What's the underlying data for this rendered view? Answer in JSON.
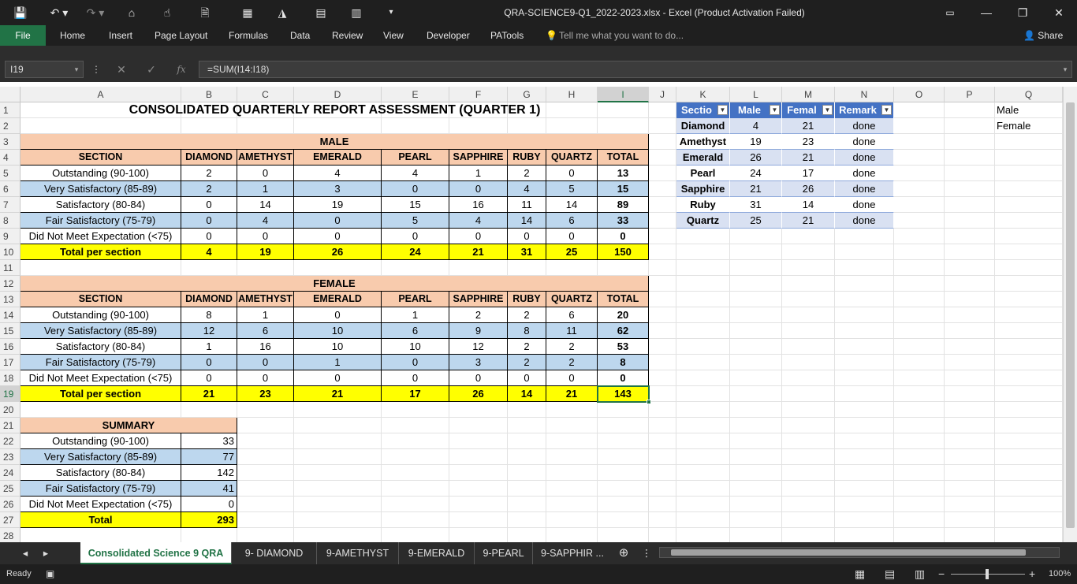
{
  "window": {
    "title": "QRA-SCIENCE9-Q1_2022-2023.xlsx - Excel (Product Activation Failed)"
  },
  "ribbon": {
    "tabs": [
      "File",
      "Home",
      "Insert",
      "Page Layout",
      "Formulas",
      "Data",
      "Review",
      "View",
      "Developer",
      "PATools"
    ],
    "tell_me": "Tell me what you want to do...",
    "share": "Share"
  },
  "formula_bar": {
    "name_box": "I19",
    "fx": "fx",
    "formula": "=SUM(I14:I18)"
  },
  "sheet": {
    "title": "CONSOLIDATED QUARTERLY REPORT ASSESSMENT (QUARTER 1)",
    "male": {
      "label": "MALE",
      "headers": [
        "SECTION",
        "DIAMOND",
        "AMETHYST",
        "EMERALD",
        "PEARL",
        "SAPPHIRE",
        "RUBY",
        "QUARTZ",
        "TOTAL"
      ],
      "rows": [
        [
          "Outstanding (90-100)",
          "2",
          "0",
          "4",
          "4",
          "1",
          "2",
          "0",
          "13"
        ],
        [
          "Very Satisfactory (85-89)",
          "2",
          "1",
          "3",
          "0",
          "0",
          "4",
          "5",
          "15"
        ],
        [
          "Satisfactory (80-84)",
          "0",
          "14",
          "19",
          "15",
          "16",
          "11",
          "14",
          "89"
        ],
        [
          "Fair Satisfactory (75-79)",
          "0",
          "4",
          "0",
          "5",
          "4",
          "14",
          "6",
          "33"
        ],
        [
          "Did Not Meet Expectation (<75)",
          "0",
          "0",
          "0",
          "0",
          "0",
          "0",
          "0",
          "0"
        ],
        [
          "Total per section",
          "4",
          "19",
          "26",
          "24",
          "21",
          "31",
          "25",
          "150"
        ]
      ]
    },
    "female": {
      "label": "FEMALE",
      "headers": [
        "SECTION",
        "DIAMOND",
        "AMETHYST",
        "EMERALD",
        "PEARL",
        "SAPPHIRE",
        "RUBY",
        "QUARTZ",
        "TOTAL"
      ],
      "rows": [
        [
          "Outstanding (90-100)",
          "8",
          "1",
          "0",
          "1",
          "2",
          "2",
          "6",
          "20"
        ],
        [
          "Very Satisfactory (85-89)",
          "12",
          "6",
          "10",
          "6",
          "9",
          "8",
          "11",
          "62"
        ],
        [
          "Satisfactory (80-84)",
          "1",
          "16",
          "10",
          "10",
          "12",
          "2",
          "2",
          "53"
        ],
        [
          "Fair Satisfactory (75-79)",
          "0",
          "0",
          "1",
          "0",
          "3",
          "2",
          "2",
          "8"
        ],
        [
          "Did Not Meet Expectation (<75)",
          "0",
          "0",
          "0",
          "0",
          "0",
          "0",
          "0",
          "0"
        ],
        [
          "Total per section",
          "21",
          "23",
          "21",
          "17",
          "26",
          "14",
          "21",
          "143"
        ]
      ]
    },
    "summary": {
      "label": "SUMMARY",
      "rows": [
        [
          "Outstanding (90-100)",
          "33"
        ],
        [
          "Very Satisfactory (85-89)",
          "77"
        ],
        [
          "Satisfactory (80-84)",
          "142"
        ],
        [
          "Fair Satisfactory (75-79)",
          "41"
        ],
        [
          "Did Not Meet Expectation (<75)",
          "0"
        ],
        [
          "Total",
          "293"
        ]
      ]
    },
    "side_table": {
      "headers": [
        "Sectio",
        "Male",
        "Femal",
        "Remark"
      ],
      "rows": [
        [
          "Diamond",
          "4",
          "21",
          "done"
        ],
        [
          "Amethyst",
          "19",
          "23",
          "done"
        ],
        [
          "Emerald",
          "26",
          "21",
          "done"
        ],
        [
          "Pearl",
          "24",
          "17",
          "done"
        ],
        [
          "Sapphire",
          "21",
          "26",
          "done"
        ],
        [
          "Ruby",
          "31",
          "14",
          "done"
        ],
        [
          "Quartz",
          "25",
          "21",
          "done"
        ]
      ]
    },
    "q_column": [
      "Male",
      "Female"
    ]
  },
  "columns": [
    "A",
    "B",
    "C",
    "D",
    "E",
    "F",
    "G",
    "H",
    "I",
    "J",
    "K",
    "L",
    "M",
    "N",
    "O",
    "P",
    "Q"
  ],
  "rows": [
    "1",
    "2",
    "3",
    "4",
    "5",
    "6",
    "7",
    "8",
    "9",
    "10",
    "11",
    "12",
    "13",
    "14",
    "15",
    "16",
    "17",
    "18",
    "19",
    "20",
    "21",
    "22",
    "23",
    "24",
    "25",
    "26",
    "27",
    "28"
  ],
  "sheet_tabs": [
    "Consolidated Science 9 QRA",
    "9- DIAMOND",
    "9-AMETHYST",
    "9-EMERALD",
    "9-PEARL",
    "9-SAPPHIR ..."
  ],
  "status": {
    "ready": "Ready",
    "zoom": "100%"
  },
  "colors": {
    "accent": "#217346",
    "header_peach": "#f8cbad",
    "row_blue": "#bdd7ee",
    "total_yellow": "#ffff00",
    "table_blue": "#4472c4"
  }
}
